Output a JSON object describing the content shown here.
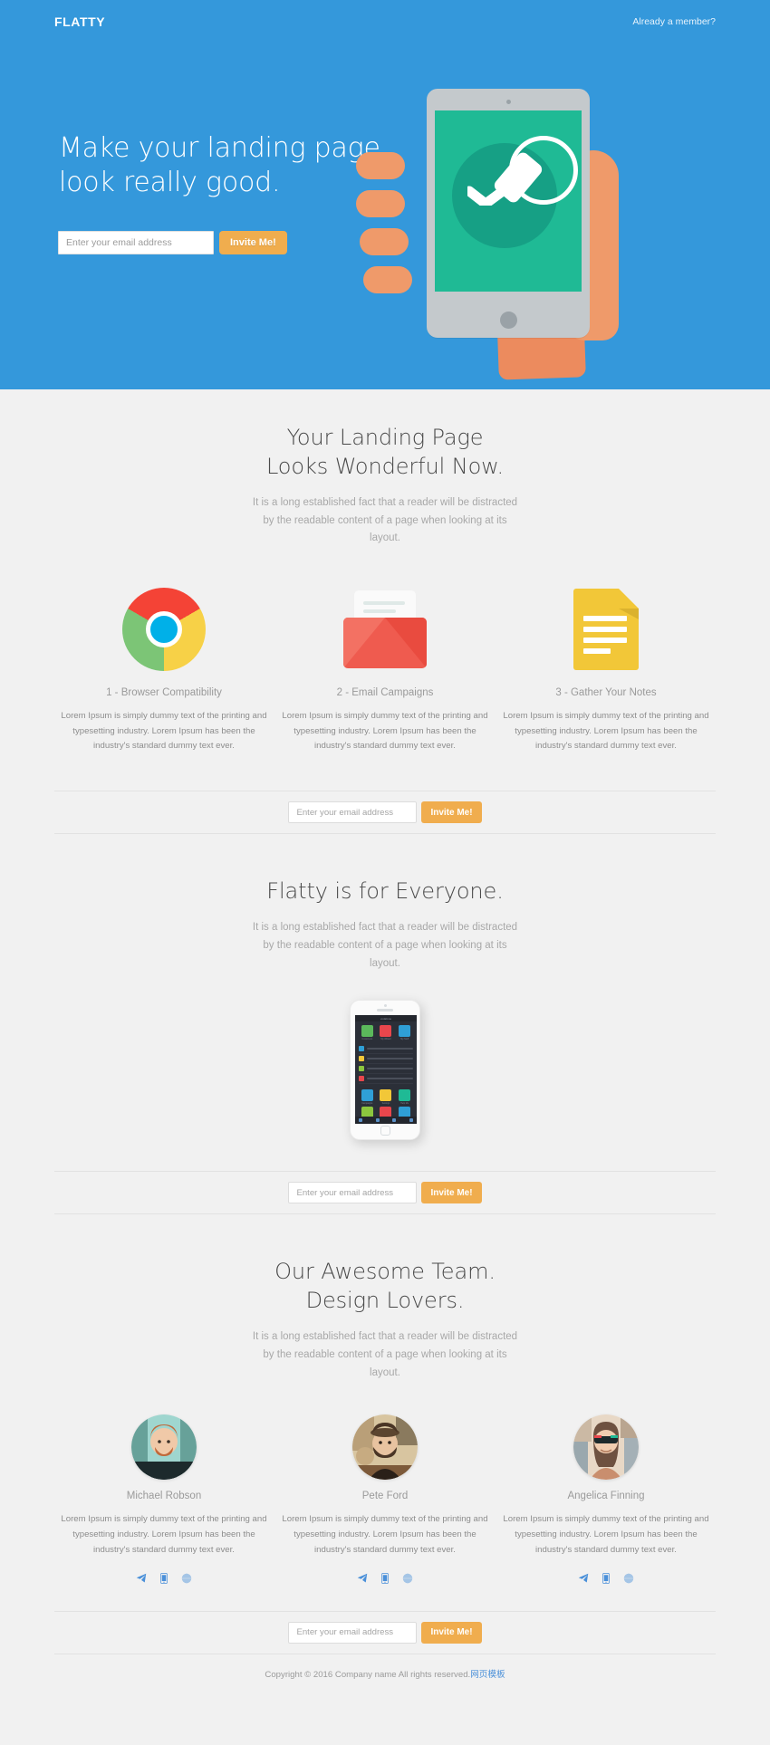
{
  "header": {
    "logo": "FLATTY",
    "member_link": "Already a member?"
  },
  "hero": {
    "title_line1": "Make your landing page",
    "title_line2": "look really good.",
    "email_placeholder": "Enter your email address",
    "email_value": "",
    "invite_label": "Invite Me!",
    "bg_color": "#3498db",
    "button_color": "#f0ad4e",
    "tablet_screen_color": "#1fba95"
  },
  "features_section": {
    "title_line1": "Your Landing Page",
    "title_line2": "Looks Wonderful Now.",
    "subtitle": "It is a long established fact that a reader will be distracted by the readable content of a page when looking at its layout.",
    "items": [
      {
        "icon": "chrome-icon",
        "title": "1 - Browser Compatibility",
        "text": "Lorem Ipsum is simply dummy text of the printing and typesetting industry. Lorem Ipsum has been the industry's standard dummy text ever."
      },
      {
        "icon": "envelope-icon",
        "title": "2 - Email Campaigns",
        "text": "Lorem Ipsum is simply dummy text of the printing and typesetting industry. Lorem Ipsum has been the industry's standard dummy text ever."
      },
      {
        "icon": "note-document-icon",
        "title": "3 - Gather Your Notes",
        "text": "Lorem Ipsum is simply dummy text of the printing and typesetting industry. Lorem Ipsum has been the industry's standard dummy text ever."
      }
    ]
  },
  "form_strip_1": {
    "email_placeholder": "Enter your email address",
    "email_value": "",
    "invite_label": "Invite Me!"
  },
  "everyone_section": {
    "title": "Flatty is for Everyone.",
    "subtitle": "It is a long established fact that a reader will be distracted by the readable content of a page when looking at its layout.",
    "phone": {
      "status_label": "vodafone",
      "tiles": [
        {
          "label": "Customers",
          "color": "#5bb85b"
        },
        {
          "label": "My Wizard",
          "color": "#e8464c"
        },
        {
          "label": "My Stuff",
          "color": "#2f9fd6"
        },
        {
          "label": "Campaigns",
          "color": "#2f9fd6"
        },
        {
          "label": "Settings",
          "color": "#f2c738"
        },
        {
          "label": "Help Me",
          "color": "#1fba95"
        },
        {
          "label": "My Writer",
          "color": "#8cc63e"
        },
        {
          "label": "Contacts",
          "color": "#e8464c"
        },
        {
          "label": "Tweets",
          "color": "#2f9fd6"
        }
      ],
      "rows": [
        {
          "label": "My Friend Added",
          "color": "#2f9fd6"
        },
        {
          "label": "My Wizard Space",
          "color": "#f2c738"
        },
        {
          "label": "Planning Card Space",
          "color": "#8cc63e"
        },
        {
          "label": "Conference Interface Planner",
          "color": "#e8464c"
        }
      ]
    }
  },
  "form_strip_2": {
    "email_placeholder": "Enter your email address",
    "email_value": "",
    "invite_label": "Invite Me!"
  },
  "team_section": {
    "title_line1": "Our Awesome Team.",
    "title_line2": "Design Lovers.",
    "subtitle": "It is a long established fact that a reader will be distracted by the readable content of a page when looking at its layout.",
    "social_icons": [
      "paper-plane-icon",
      "mobile-phone-icon",
      "globe-icon"
    ],
    "members": [
      {
        "name": "Michael Robson",
        "text": "Lorem Ipsum is simply dummy text of the printing and typesetting industry. Lorem Ipsum has been the industry's standard dummy text ever.",
        "avatar_colors": [
          "#9fd6cf",
          "#2f6b63",
          "#1d2a2c"
        ]
      },
      {
        "name": "Pete Ford",
        "text": "Lorem Ipsum is simply dummy text of the printing and typesetting industry. Lorem Ipsum has been the industry's standard dummy text ever.",
        "avatar_colors": [
          "#d8c5a0",
          "#7d5a3a",
          "#2a2018"
        ]
      },
      {
        "name": "Angelica Finning",
        "text": "Lorem Ipsum is simply dummy text of the printing and typesetting industry. Lorem Ipsum has been the industry's standard dummy text ever.",
        "avatar_colors": [
          "#e8d8c6",
          "#c98e6e",
          "#3a3330"
        ]
      }
    ]
  },
  "form_strip_3": {
    "email_placeholder": "Enter your email address",
    "email_value": "",
    "invite_label": "Invite Me!"
  },
  "footer": {
    "copyright": "Copyright © 2016 Company name All rights reserved.",
    "link": "网页模板"
  }
}
